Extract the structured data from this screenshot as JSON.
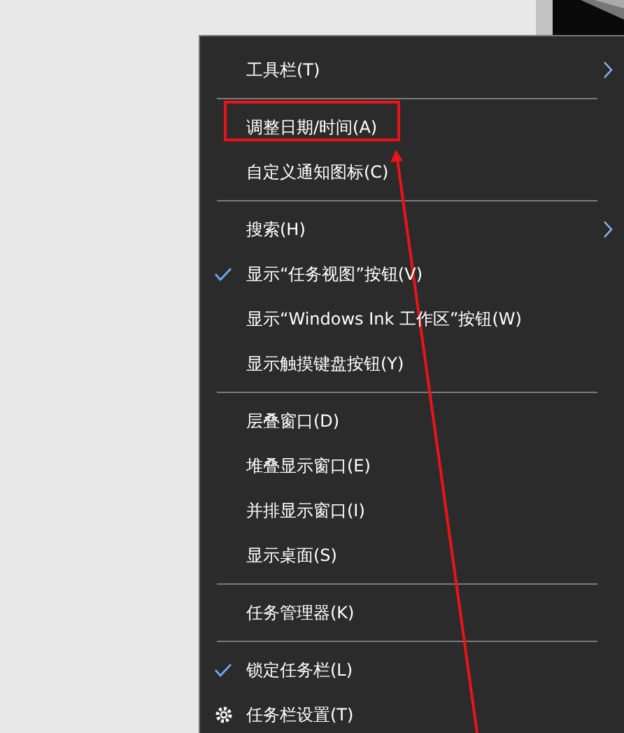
{
  "menu": {
    "items": [
      {
        "kind": "item",
        "label": "工具栏(T)",
        "checked": false,
        "submenu": true,
        "highlighted": false
      },
      {
        "kind": "separator"
      },
      {
        "kind": "item",
        "label": "调整日期/时间(A)",
        "checked": false,
        "submenu": false,
        "highlighted": true
      },
      {
        "kind": "item",
        "label": "自定义通知图标(C)",
        "checked": false,
        "submenu": false,
        "highlighted": false
      },
      {
        "kind": "separator"
      },
      {
        "kind": "item",
        "label": "搜索(H)",
        "checked": false,
        "submenu": true,
        "highlighted": false
      },
      {
        "kind": "item",
        "label": "显示“任务视图”按钮(V)",
        "checked": true,
        "submenu": false,
        "highlighted": false
      },
      {
        "kind": "item",
        "label": "显示“Windows Ink 工作区”按钮(W)",
        "checked": false,
        "submenu": false,
        "highlighted": false
      },
      {
        "kind": "item",
        "label": "显示触摸键盘按钮(Y)",
        "checked": false,
        "submenu": false,
        "highlighted": false
      },
      {
        "kind": "separator"
      },
      {
        "kind": "item",
        "label": "层叠窗口(D)",
        "checked": false,
        "submenu": false,
        "highlighted": false
      },
      {
        "kind": "item",
        "label": "堆叠显示窗口(E)",
        "checked": false,
        "submenu": false,
        "highlighted": false
      },
      {
        "kind": "item",
        "label": "并排显示窗口(I)",
        "checked": false,
        "submenu": false,
        "highlighted": false
      },
      {
        "kind": "item",
        "label": "显示桌面(S)",
        "checked": false,
        "submenu": false,
        "highlighted": false
      },
      {
        "kind": "separator"
      },
      {
        "kind": "item",
        "label": "任务管理器(K)",
        "checked": false,
        "submenu": false,
        "highlighted": false
      },
      {
        "kind": "separator"
      },
      {
        "kind": "item",
        "label": "锁定任务栏(L)",
        "checked": true,
        "submenu": false,
        "highlighted": false
      },
      {
        "kind": "settings",
        "label": "任务栏设置(T)",
        "checked": false,
        "submenu": false,
        "highlighted": false
      }
    ]
  }
}
